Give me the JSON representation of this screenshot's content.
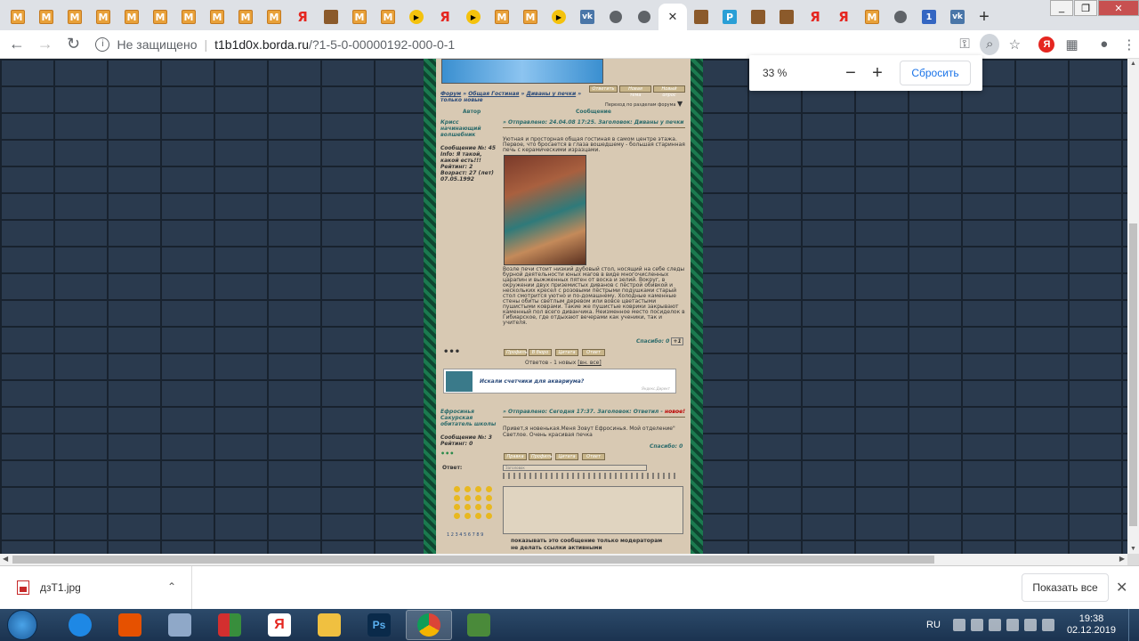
{
  "browser": {
    "tabs": [
      {
        "icon": "m"
      },
      {
        "icon": "m"
      },
      {
        "icon": "m"
      },
      {
        "icon": "m"
      },
      {
        "icon": "m"
      },
      {
        "icon": "m"
      },
      {
        "icon": "m"
      },
      {
        "icon": "m"
      },
      {
        "icon": "m"
      },
      {
        "icon": "m"
      },
      {
        "icon": "ya"
      },
      {
        "icon": "pic"
      },
      {
        "icon": "m"
      },
      {
        "icon": "m"
      },
      {
        "icon": "play"
      },
      {
        "icon": "ya"
      },
      {
        "icon": "play"
      },
      {
        "icon": "m"
      },
      {
        "icon": "m"
      },
      {
        "icon": "play"
      },
      {
        "icon": "vk"
      },
      {
        "icon": "globe"
      },
      {
        "icon": "globe"
      },
      {
        "icon": "close",
        "active": true
      },
      {
        "icon": "pic"
      },
      {
        "icon": "sq"
      },
      {
        "icon": "pic"
      },
      {
        "icon": "pic"
      },
      {
        "icon": "ya"
      },
      {
        "icon": "ya"
      },
      {
        "icon": "m"
      },
      {
        "icon": "globe"
      },
      {
        "icon": "num"
      },
      {
        "icon": "vk"
      }
    ],
    "new_tab": "+",
    "address": {
      "security": "Не защищено",
      "host": "t1b1d0x.borda.ru",
      "path": "/?1-5-0-00000192-000-0-1"
    },
    "zoom_popup": {
      "percent": "33 %",
      "minus": "−",
      "plus": "+",
      "reset": "Сбросить"
    }
  },
  "forum": {
    "buttons_top": [
      "Ответить",
      "Новая тема",
      "Новый опрос"
    ],
    "breadcrumb": {
      "forum": "Форум",
      "sep1": " » ",
      "section": "Общая Гостиная",
      "sep2": " » ",
      "topic": "Диваны у печки",
      "sep3": " » ",
      "suffix": "только новые"
    },
    "jump": "Переход по разделам форума",
    "col_author": "Автор",
    "col_message": "Сообщение",
    "post1": {
      "author": "Крисс",
      "rank": "начинающий волшебник",
      "stats": [
        "Сообщение №: 45",
        "Info: Я такой, какой есть!!!",
        "Рейтинг: 2",
        "Возраст: 27 (лет)",
        "07.05.1992"
      ],
      "header": "» Отправлено: 24.04.08 17:25. Заголовок: Диваны у печки",
      "text1": "Уютная и просторная общая гостиная в самом центре этажа. Первое, что бросается в глаза вошедшему - большая старинная печь с керамическими изразцами.",
      "text2": "Возле печи стоит низкий дубовый стол, носящий на себе следы бурной деятельности юных магов в виде многочисленных царапин и выжженных пятен от воска и зелий. Вокруг, в окружении двух приземистых диванов с пёстрой обивкой и нескольких кресел с розовыми пёстрыми подушками старый стол смотрится уютно и по-домашнему. Холодные каменные стены обиты светлым деревом или вовсе цветастыми пушистыми коврами. Такие же пушистые коврики закрывают каменный пол всего диванчика. Неизменное место посиделок в Гибиарское, где отдыхают вечерами как ученики, так и учителя.",
      "thanks": "Спасибо: 0",
      "thanks_plus": "+1",
      "buttons": [
        "Профиль",
        "В бюро",
        "Цитата",
        "Ответ"
      ],
      "dots": "•••"
    },
    "replies": "Ответов - 1 новых",
    "replies_link": "[вн. все]",
    "ad": {
      "title": "Искали счетчики для аквариума?",
      "source": "Яндекс.Директ"
    },
    "post2": {
      "author": "Ефросинья",
      "rank": "Сакурская обитатель школы",
      "stats": [
        "Сообщение №: 3",
        "Рейтинг: 0"
      ],
      "header": "» Отправлено: Сегодня 17:37. Заголовок: Ответил",
      "header_new": "новое!",
      "text": "Привет,я новенькая.Меня Зовут Ефросинья. Мой отделение\" Светлое. Очень красивая печка",
      "thanks": "Спасибо: 0",
      "buttons": [
        "Правка",
        "Профиль",
        "Цитата",
        "Ответ"
      ],
      "dots": "•••"
    },
    "reply_form": {
      "label": "Ответ:",
      "subject_placeholder": "Заголовок",
      "pages": "1 2 3 4 5 6 7 8 9",
      "mod_only": "показывать это сообщение только модераторам",
      "no_links": "не делать ссылки активными"
    }
  },
  "download": {
    "file": "дзT1.jpg",
    "show_all": "Показать все"
  },
  "taskbar": {
    "lang": "RU",
    "time": "19:38",
    "date": "02.12.2019"
  }
}
